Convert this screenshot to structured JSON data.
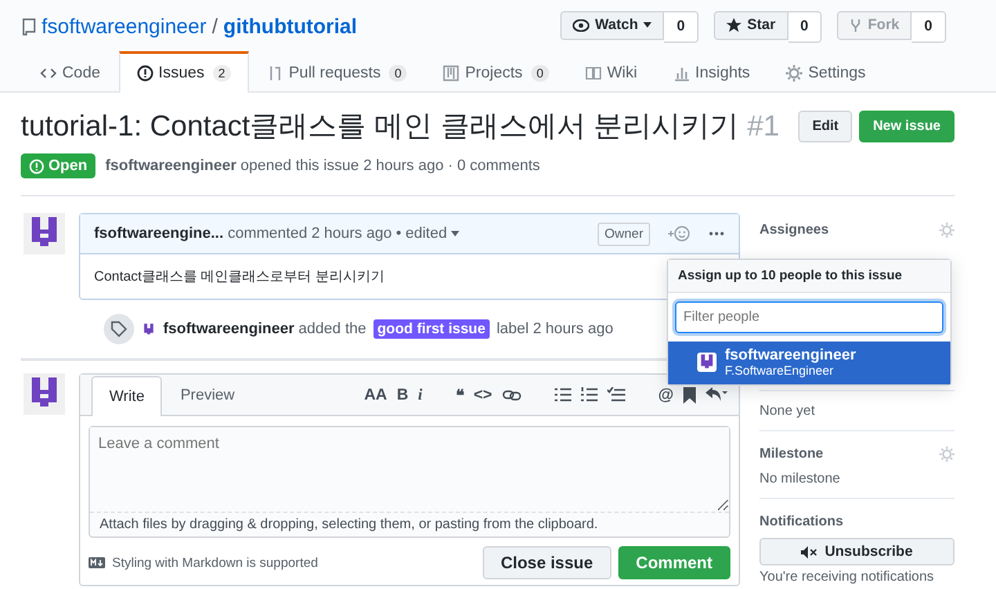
{
  "repo": {
    "owner": "fsoftwareengineer",
    "separator": "/",
    "name": "githubtutorial"
  },
  "repo_actions": [
    {
      "kind": "watch",
      "label": "Watch",
      "count": "0",
      "disabled": false
    },
    {
      "kind": "star",
      "label": "Star",
      "count": "0",
      "disabled": false
    },
    {
      "kind": "fork",
      "label": "Fork",
      "count": "0",
      "disabled": true
    }
  ],
  "tabs": [
    {
      "kind": "code",
      "label": "Code",
      "selected": false
    },
    {
      "kind": "issues",
      "label": "Issues",
      "count": "2",
      "selected": true
    },
    {
      "kind": "pulls",
      "label": "Pull requests",
      "count": "0",
      "selected": false
    },
    {
      "kind": "projects",
      "label": "Projects",
      "count": "0",
      "selected": false
    },
    {
      "kind": "wiki",
      "label": "Wiki",
      "selected": false
    },
    {
      "kind": "insights",
      "label": "Insights",
      "selected": false
    },
    {
      "kind": "settings",
      "label": "Settings",
      "selected": false
    }
  ],
  "issue": {
    "title": "tutorial-1: Contact클래스를 메인 클래스에서 분리시키기",
    "number": "#1",
    "status": "Open",
    "author": "fsoftwareengineer",
    "meta": "opened this issue 2 hours ago · 0 comments"
  },
  "header_buttons": [
    {
      "kind": "plain",
      "label": "Edit"
    },
    {
      "kind": "primary",
      "label": "New issue"
    }
  ],
  "comment": {
    "author": "fsoftwareengine...",
    "meta": "commented 2 hours ago •",
    "edited": "edited",
    "role": "Owner",
    "body": "Contact클래스를 메인클래스로부터 분리시키기"
  },
  "event": {
    "author": "fsoftwareengineer",
    "before": "added the",
    "label": {
      "text": "good first issue",
      "color": "#7057ff"
    },
    "after": "label 2 hours ago"
  },
  "editor": {
    "tabs": [
      {
        "label": "Write",
        "selected": true
      },
      {
        "label": "Preview",
        "selected": false
      }
    ],
    "toolbar": [
      {
        "kind": "text",
        "glyph": "AA"
      },
      {
        "kind": "text",
        "glyph": "B"
      },
      {
        "kind": "italic",
        "glyph": "i"
      },
      {
        "kind": "gap"
      },
      {
        "kind": "text",
        "glyph": "❝"
      },
      {
        "kind": "text",
        "glyph": "<>"
      },
      {
        "kind": "link"
      },
      {
        "kind": "gap"
      },
      {
        "kind": "list"
      },
      {
        "kind": "olist"
      },
      {
        "kind": "tasks"
      },
      {
        "kind": "gap"
      },
      {
        "kind": "text",
        "glyph": "@"
      },
      {
        "kind": "bookmark"
      },
      {
        "kind": "reply"
      }
    ],
    "placeholder": "Leave a comment",
    "attach": "Attach files by dragging & dropping, selecting them, or pasting from the clipboard.",
    "markdown_note": "Styling with Markdown is supported",
    "buttons": [
      {
        "kind": "plain",
        "label": "Close issue"
      },
      {
        "kind": "primary",
        "label": "Comment"
      }
    ]
  },
  "sidebar": [
    {
      "kind": "assignees",
      "title": "Assignees",
      "gear": true
    },
    {
      "kind": "section",
      "value": "None yet"
    },
    {
      "kind": "section",
      "title": "Milestone",
      "value": "No milestone",
      "gear": true
    },
    {
      "kind": "notifications",
      "title": "Notifications",
      "button": "Unsubscribe",
      "value": "You're receiving notifications",
      "gear": false
    }
  ],
  "dropdown": {
    "title": "Assign up to 10 people to this issue",
    "placeholder": "Filter people",
    "users": [
      {
        "login": "fsoftwareengineer",
        "name": "F.SoftwareEngineer",
        "selected": true
      }
    ]
  }
}
